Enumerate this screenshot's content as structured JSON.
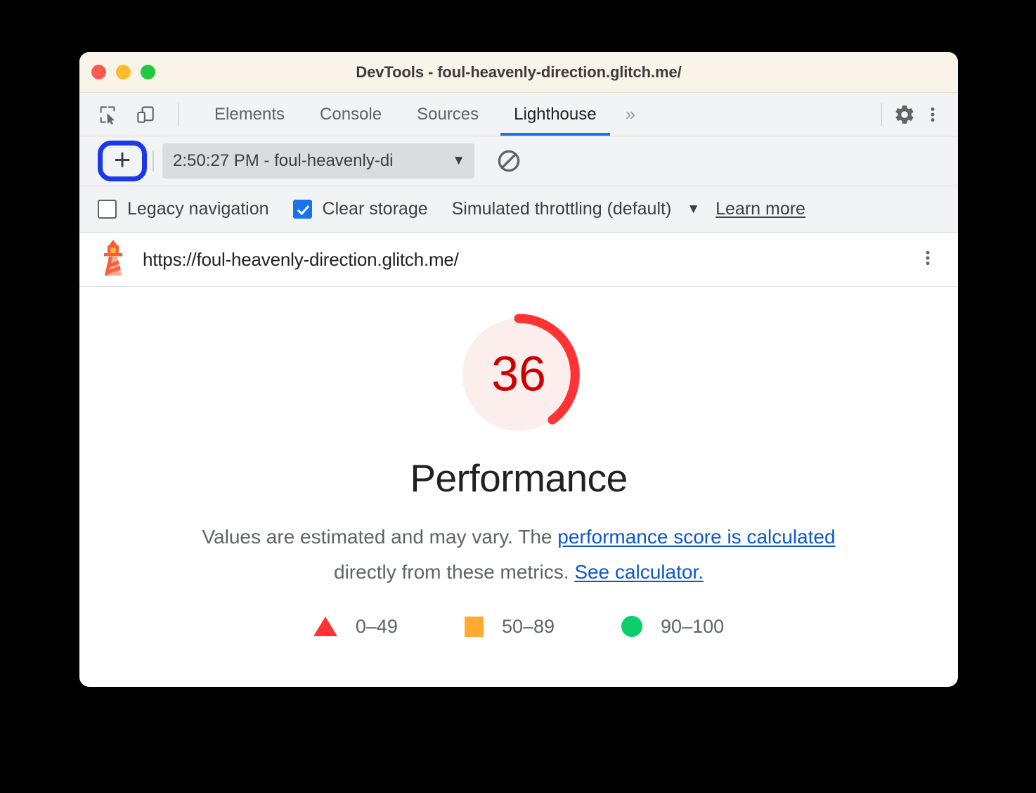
{
  "window": {
    "title": "DevTools - foul-heavenly-direction.glitch.me/",
    "traffic_lights": [
      "close",
      "minimize",
      "maximize"
    ]
  },
  "devtools": {
    "left_icons": [
      {
        "name": "inspect-element-icon",
        "label": "Inspect element"
      },
      {
        "name": "device-toolbar-icon",
        "label": "Toggle device toolbar"
      }
    ],
    "tabs": [
      {
        "label": "Elements",
        "active": false
      },
      {
        "label": "Console",
        "active": false
      },
      {
        "label": "Sources",
        "active": false
      },
      {
        "label": "Lighthouse",
        "active": true
      }
    ],
    "more_tabs_glyph": "»",
    "right_icons": [
      {
        "name": "settings-gear-icon",
        "label": "Settings"
      },
      {
        "name": "more-options-kebab-icon",
        "label": "Customize and control DevTools"
      }
    ]
  },
  "lighthouse_toolbar": {
    "add_button_label": "+",
    "add_button_highlighted": true,
    "report_select_value": "2:50:27 PM - foul-heavenly-di",
    "report_select_caret": "▼",
    "clear_button_label": "Clear all"
  },
  "settings_row": {
    "legacy_navigation": {
      "label": "Legacy navigation",
      "checked": false
    },
    "clear_storage": {
      "label": "Clear storage",
      "checked": true
    },
    "throttling": {
      "label": "Simulated throttling (default)",
      "caret": "▼"
    },
    "learn_more_label": "Learn more"
  },
  "url_row": {
    "icon": "lighthouse-logo-icon",
    "url": "https://foul-heavenly-direction.glitch.me/",
    "kebab_label": "Report options"
  },
  "report": {
    "score": "36",
    "category_title": "Performance",
    "disclaimer_prefix": "Values are estimated and may vary. The ",
    "disclaimer_link1": "performance score is calculated",
    "disclaimer_middle": " directly from these metrics. ",
    "disclaimer_link2": "See calculator.",
    "legend": [
      {
        "shape": "triangle",
        "label": "0–49",
        "color": "#ff3333"
      },
      {
        "shape": "square",
        "label": "50–89",
        "color": "#ffaa33"
      },
      {
        "shape": "circle",
        "label": "90–100",
        "color": "#0cce6b"
      }
    ]
  },
  "chart_data": {
    "type": "gauge",
    "title": "Performance",
    "value": 36,
    "min": 0,
    "max": 100,
    "arc_color": "#f33",
    "track_color": "#fff0f0",
    "score_color": "#cc0000",
    "bands": [
      {
        "range": [
          0,
          49
        ],
        "label": "0–49",
        "color": "#ff3333"
      },
      {
        "range": [
          50,
          89
        ],
        "label": "50–89",
        "color": "#ffaa33"
      },
      {
        "range": [
          90,
          100
        ],
        "label": "90–100",
        "color": "#0cce6b"
      }
    ]
  },
  "colors": {
    "accent_blue": "#1a73e8",
    "highlight_blue": "#1a37ea",
    "link_blue": "#0b57d0",
    "titlebar_bg": "#faf3e9",
    "toolbar_bg": "#f1f3f4"
  }
}
